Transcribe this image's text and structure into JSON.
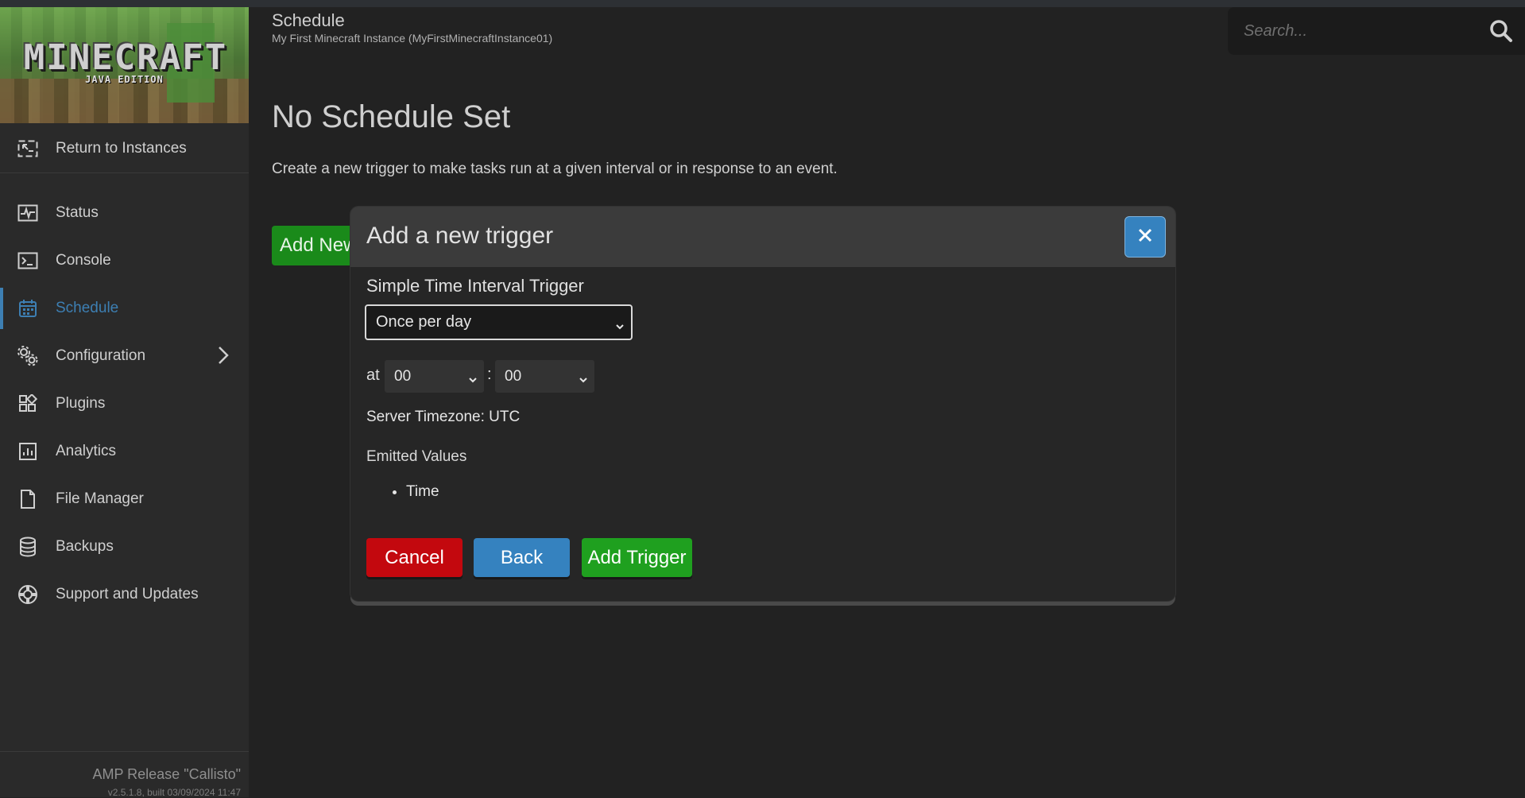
{
  "sidebar": {
    "logo": {
      "wordmark": "MINECRAFT",
      "edition": "JAVA EDITION"
    },
    "return_label": "Return to Instances",
    "items": [
      {
        "label": "Status",
        "icon": "status-icon"
      },
      {
        "label": "Console",
        "icon": "console-icon"
      },
      {
        "label": "Schedule",
        "icon": "calendar-icon",
        "active": true
      },
      {
        "label": "Configuration",
        "icon": "gears-icon",
        "has_submenu": true
      },
      {
        "label": "Plugins",
        "icon": "plugins-icon"
      },
      {
        "label": "Analytics",
        "icon": "analytics-icon"
      },
      {
        "label": "File Manager",
        "icon": "file-icon"
      },
      {
        "label": "Backups",
        "icon": "database-icon"
      },
      {
        "label": "Support and Updates",
        "icon": "lifebuoy-icon"
      }
    ],
    "footer": {
      "release": "AMP Release \"Callisto\"",
      "version": "v2.5.1.8, built 03/09/2024 11:47"
    }
  },
  "header": {
    "title": "Schedule",
    "subtitle": "My First Minecraft Instance (MyFirstMinecraftInstance01)"
  },
  "search": {
    "placeholder": "Search...",
    "value": ""
  },
  "main": {
    "heading": "No Schedule Set",
    "description": "Create a new trigger to make tasks run at a given interval or in response to an event.",
    "add_button_label": "Add New"
  },
  "modal": {
    "title": "Add a new trigger",
    "trigger_type_label": "Simple Time Interval Trigger",
    "interval_value": "Once per day",
    "at_label": "at",
    "hour_value": "00",
    "time_separator": ":",
    "minute_value": "00",
    "timezone_text": "Server Timezone: UTC",
    "emitted_label": "Emitted Values",
    "emitted_values": [
      "Time"
    ],
    "buttons": {
      "cancel": "Cancel",
      "back": "Back",
      "add": "Add Trigger"
    }
  },
  "colors": {
    "accent": "#3582bf",
    "danger": "#c3080e",
    "success": "#1fa01f",
    "background": "#222222",
    "sidebar": "#2a2a2a"
  }
}
